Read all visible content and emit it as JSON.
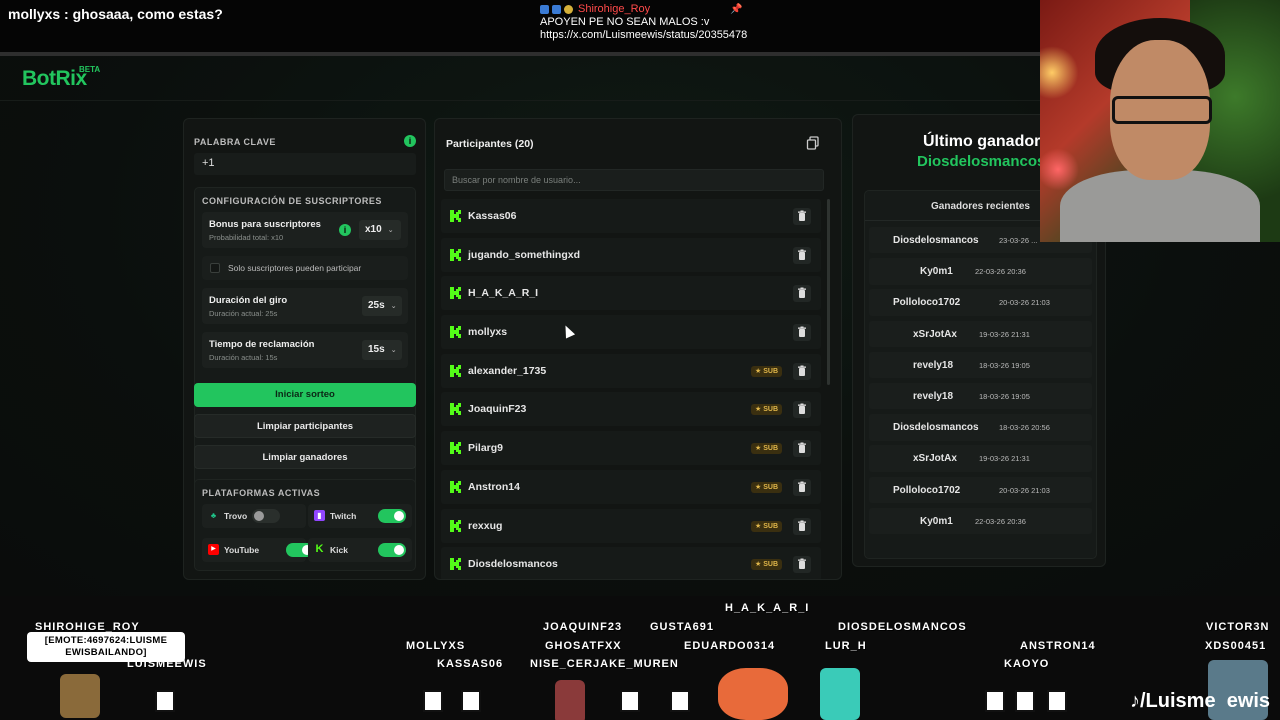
{
  "stream": {
    "chat_user": "mollyxs",
    "chat_text": ": ghosaaa, como estas?",
    "pinned_user": "Shirohige_Roy",
    "pinned_line1": "APOYEN PE NO SEAN MALOS :v",
    "pinned_line2": "https://x.com/Luismeewis/status/20355478",
    "emote_bubble": "[EMOTE:4697624:LUISME EWISBAILANDO]",
    "tiktok_handle": "/Luisme  ewis",
    "overlay_names": [
      "SHIROHIGE_ROY",
      "LUISMEEWIS",
      "MOLLYXS",
      "KASSAS06",
      "JOAQUINF23",
      "GHOSATFXX",
      "NISE_CERJAKE_MUREN",
      "GUSTA691",
      "EDUARDO0314",
      "H_A_K_A_R_I",
      "DIOSDELOSMANCOS",
      "LUR_H",
      "ANSTRON14",
      "KAOYO",
      "VICTOR3N",
      "XDS00451"
    ]
  },
  "app": {
    "logo": "BotRix",
    "logo_badge": "BETA"
  },
  "left": {
    "keyword_label": "PALABRA CLAVE",
    "keyword_value": "+1",
    "subs_title": "CONFIGURACIÓN DE SUSCRIPTORES",
    "bonus_title": "Bonus para suscriptores",
    "bonus_sub": "Probabilidad total: x10",
    "bonus_value": "x10",
    "subs_only": "Solo suscriptores pueden participar",
    "spin_title": "Duración del giro",
    "spin_sub": "Duración actual: 25s",
    "spin_value": "25s",
    "claim_title": "Tiempo de reclamación",
    "claim_sub": "Duración actual: 15s",
    "claim_value": "15s",
    "start_btn": "Iniciar sorteo",
    "clear_participants": "Limpiar participantes",
    "clear_winners": "Limpiar ganadores",
    "platforms_title": "PLATAFORMAS ACTIVAS",
    "platforms": [
      {
        "name": "Trovo",
        "on": false,
        "color": "#1fc68a"
      },
      {
        "name": "Twitch",
        "on": true,
        "color": "#9146ff"
      },
      {
        "name": "YouTube",
        "on": true,
        "color": "#ff0000"
      },
      {
        "name": "Kick",
        "on": true,
        "color": "#53fc18"
      }
    ]
  },
  "middle": {
    "title": "Participantes (20)",
    "search_placeholder": "Buscar por nombre de usuario...",
    "sub_badge": "SUB",
    "participants": [
      {
        "name": "Kassas06",
        "sub": false
      },
      {
        "name": "jugando_somethingxd",
        "sub": false
      },
      {
        "name": "H_A_K_A_R_I",
        "sub": false
      },
      {
        "name": "mollyxs",
        "sub": false
      },
      {
        "name": "alexander_1735",
        "sub": true
      },
      {
        "name": "JoaquinF23",
        "sub": true
      },
      {
        "name": "Pilarg9",
        "sub": true
      },
      {
        "name": "Anstron14",
        "sub": true
      },
      {
        "name": "rexxug",
        "sub": true
      },
      {
        "name": "Diosdelosmancos",
        "sub": true
      }
    ]
  },
  "right": {
    "last_title": "Último ganador:",
    "last_name": "Diosdelosmancos",
    "recent_title": "Ganadores recientes",
    "winners": [
      {
        "name": "Diosdelosmancos",
        "date": "23-03-26 ..."
      },
      {
        "name": "Ky0m1",
        "date": "22-03-26 20:36"
      },
      {
        "name": "Polloloco1702",
        "date": "20-03-26 21:03"
      },
      {
        "name": "xSrJotAx",
        "date": "19-03-26 21:31"
      },
      {
        "name": "revely18",
        "date": "18-03-26 19:05"
      },
      {
        "name": "revely18",
        "date": "18-03-26 19:05"
      },
      {
        "name": "Diosdelosmancos",
        "date": "18-03-26 20:56"
      },
      {
        "name": "xSrJotAx",
        "date": "19-03-26 21:31"
      },
      {
        "name": "Polloloco1702",
        "date": "20-03-26 21:03"
      },
      {
        "name": "Ky0m1",
        "date": "22-03-26 20:36"
      }
    ]
  },
  "colors": {
    "accent": "#22c55e",
    "bg": "#0b0d0c",
    "panel": "#121513",
    "sub_badge": "#e0b64a"
  }
}
